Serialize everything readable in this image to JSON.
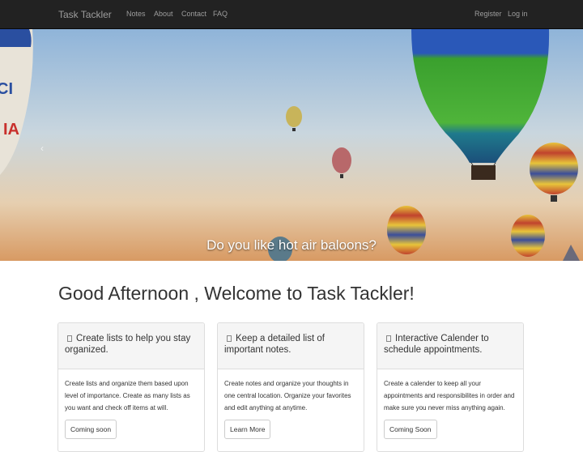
{
  "navbar": {
    "brand": "Task Tackler",
    "links": [
      "Notes",
      "About",
      "Contact",
      "FAQ"
    ],
    "right_links": [
      "Register",
      "Log in"
    ]
  },
  "carousel": {
    "caption": "Do you like hot air baloons?",
    "indicator_count": 4,
    "active_indicator": 1,
    "prev_icon": "chevron-left-icon"
  },
  "welcome": {
    "heading": "Good Afternoon , Welcome to Task Tackler!"
  },
  "features": [
    {
      "title": "Create lists to help you stay organized.",
      "body": "Create lists and organize them based upon level of importance. Create as many lists as you want and check off items at will.",
      "button": "Coming soon"
    },
    {
      "title": "Keep a detailed list of important notes.",
      "body": "Create notes and organize your thoughts in one central location. Organize your favorites and edit anything at anytime.",
      "button": "Learn More"
    },
    {
      "title": "Interactive Calender to schedule appointments.",
      "body": "Create a calender to keep all your appointments and responsibilites in order and make sure you never miss anything again.",
      "button": "Coming Soon"
    }
  ]
}
